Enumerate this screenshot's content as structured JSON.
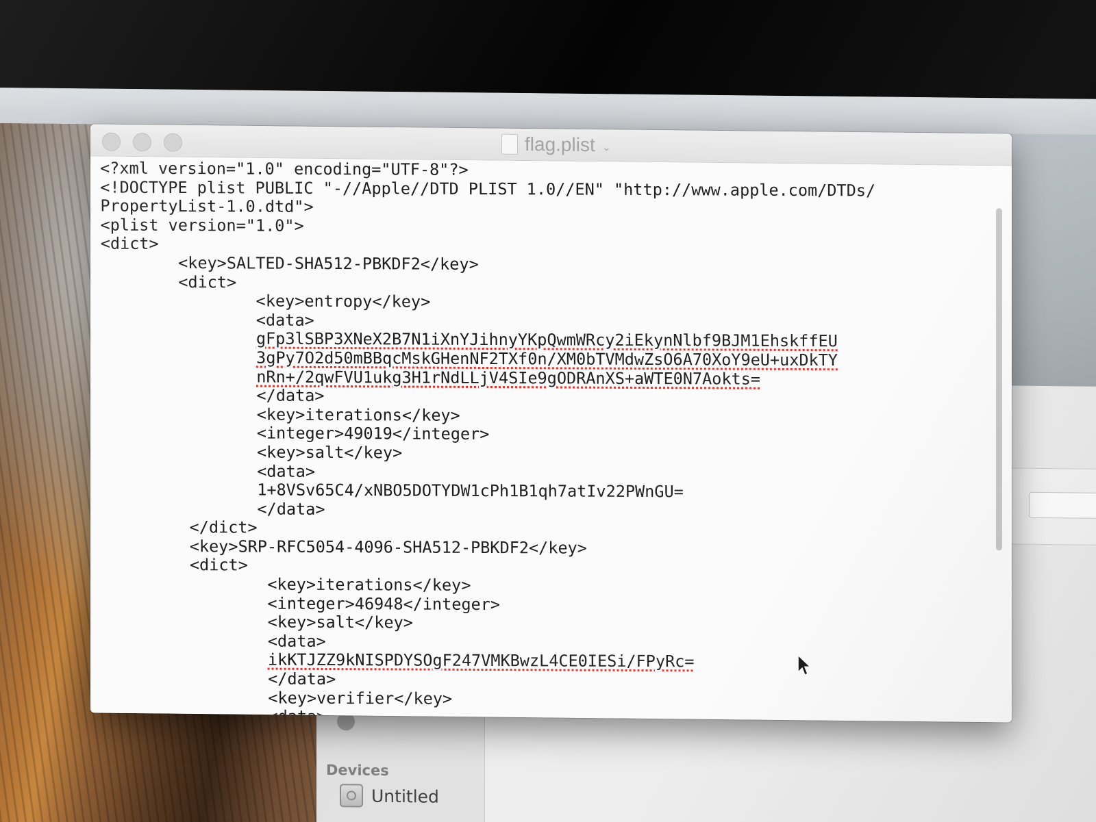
{
  "window": {
    "title": "flag.plist",
    "title_menu_icon": "chevron-down-icon",
    "document_icon": "document-icon"
  },
  "finder": {
    "sidebar": {
      "devices_heading": "Devices",
      "device_item": "Untitled",
      "device_icon": "disk-icon"
    }
  },
  "document": {
    "lines": [
      {
        "text": "<?xml version=\"1.0\" encoding=\"UTF-8\"?>",
        "spell_error": false
      },
      {
        "text": "<!DOCTYPE plist PUBLIC \"-//Apple//DTD PLIST 1.0//EN\" \"http://www.apple.com/DTDs/",
        "spell_error": false
      },
      {
        "text": "PropertyList-1.0.dtd\">",
        "spell_error": false
      },
      {
        "text": "<plist version=\"1.0\">",
        "spell_error": false
      },
      {
        "text": "<dict>",
        "spell_error": false
      },
      {
        "text": "        <key>SALTED-SHA512-PBKDF2</key>",
        "spell_error": false
      },
      {
        "text": "        <dict>",
        "spell_error": false
      },
      {
        "text": "                <key>entropy</key>",
        "spell_error": false
      },
      {
        "text": "                <data>",
        "spell_error": false
      },
      {
        "text": "                gFp3lSBP3XNeX2B7N1iXnYJihnyYKpQwmWRcy2iEkynNlbf9BJM1EhskffEU",
        "spell_error": true
      },
      {
        "text": "                3gPy7O2d50mBBqcMskGHenNF2TXf0n/XM0bTVMdwZsO6A70XoY9eU+uxDkTY",
        "spell_error": true
      },
      {
        "text": "                nRn+/2qwFVU1ukg3H1rNdLLjV4SIe9gODRAnXS+aWTE0N7Aokts=",
        "spell_error": true
      },
      {
        "text": "                </data>",
        "spell_error": false
      },
      {
        "text": "                <key>iterations</key>",
        "spell_error": false
      },
      {
        "text": "                <integer>49019</integer>",
        "spell_error": false
      },
      {
        "text": "                <key>salt</key>",
        "spell_error": false
      },
      {
        "text": "                <data>",
        "spell_error": false
      },
      {
        "text": "                1+8VSv65C4/xNBO5DOTYDW1cPh1B1qh7atIv22PWnGU=",
        "spell_error": false
      },
      {
        "text": "                </data>",
        "spell_error": false
      },
      {
        "text": "         </dict>",
        "spell_error": false
      },
      {
        "text": "         <key>SRP-RFC5054-4096-SHA512-PBKDF2</key>",
        "spell_error": false
      },
      {
        "text": "         <dict>",
        "spell_error": false
      },
      {
        "text": "                 <key>iterations</key>",
        "spell_error": false
      },
      {
        "text": "                 <integer>46948</integer>",
        "spell_error": false
      },
      {
        "text": "                 <key>salt</key>",
        "spell_error": false
      },
      {
        "text": "                 <data>",
        "spell_error": false
      },
      {
        "text": "                 ikKTJZZ9kNISPDYSOgF247VMKBwzL4CE0IESi/FPyRc=",
        "spell_error": true
      },
      {
        "text": "                 </data>",
        "spell_error": false
      },
      {
        "text": "                 <key>verifier</key>",
        "spell_error": false
      },
      {
        "text": "                 <data>",
        "spell_error": false
      }
    ]
  },
  "colors": {
    "spell_underline": "#e0302a",
    "text": "#1a1a1a",
    "title_text": "#a3a3a3"
  }
}
